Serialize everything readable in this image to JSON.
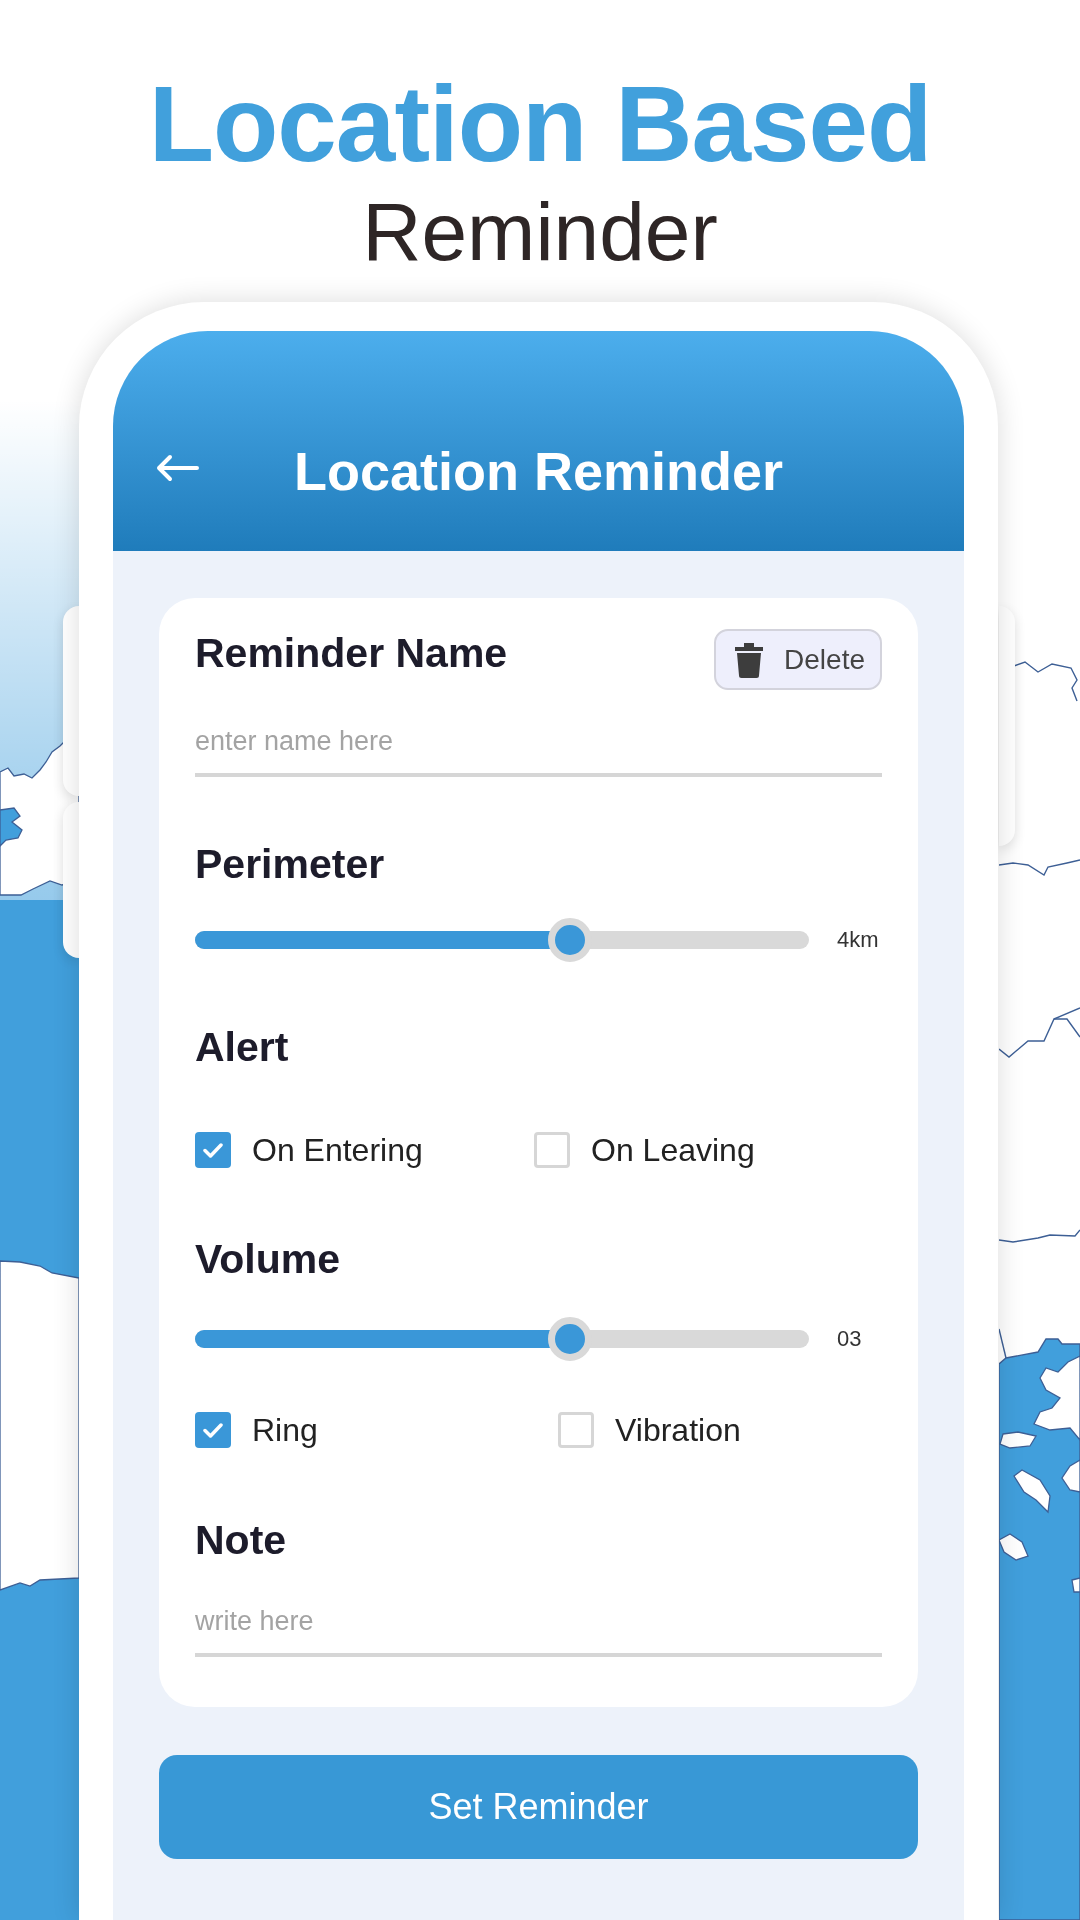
{
  "header": {
    "title": "Location Based",
    "subtitle": "Reminder"
  },
  "app_bar": {
    "title": "Location Reminder"
  },
  "form": {
    "name_field": {
      "label": "Reminder Name",
      "delete_button": "Delete",
      "placeholder": "enter name here"
    },
    "perimeter": {
      "label": "Perimeter",
      "level": 0.61,
      "reading": "4km"
    },
    "alert": {
      "label": "Alert",
      "options": [
        {
          "label": "On Entering",
          "checked": true
        },
        {
          "label": "On Leaving",
          "checked": false
        }
      ]
    },
    "volume": {
      "label": "Volume",
      "level": 0.61,
      "reading": "03",
      "options": [
        {
          "label": "Ring",
          "checked": true
        },
        {
          "label": "Vibration",
          "checked": false
        }
      ]
    },
    "note": {
      "label": "Note",
      "placeholder": "write here"
    }
  },
  "set_button": {
    "label": "Set Reminder"
  }
}
